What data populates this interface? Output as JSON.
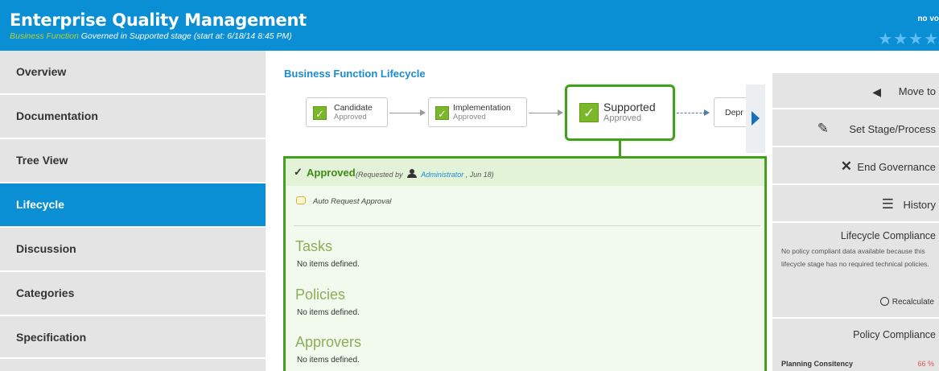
{
  "header": {
    "title": "Enterprise Quality Management",
    "type": "Business Function",
    "governance": "Governed in Supported stage (start at: 6/18/14 8:45 PM)",
    "votes": "no vo",
    "stars": "★★★★"
  },
  "nav": {
    "items": [
      {
        "label": "Overview"
      },
      {
        "label": "Documentation"
      },
      {
        "label": "Tree View"
      },
      {
        "label": "Lifecycle"
      },
      {
        "label": "Discussion"
      },
      {
        "label": "Categories"
      },
      {
        "label": "Specification"
      }
    ],
    "active": "Lifecycle"
  },
  "lifecycle": {
    "title": "Business Function Lifecycle",
    "stages": [
      {
        "name": "Candidate",
        "status": "Approved"
      },
      {
        "name": "Implementation",
        "status": "Approved"
      },
      {
        "name": "Supported",
        "status": "Approved"
      },
      {
        "name": "Depr",
        "status": ""
      }
    ],
    "check_glyph": "✓"
  },
  "approval": {
    "label": "Approved",
    "requested_by_prefix": "(Requested by",
    "user": "Administrator",
    "date": ", Jun 18)",
    "auto_request": "Auto Request Approval",
    "check_glyph": "✓"
  },
  "sections": [
    {
      "title": "Tasks",
      "empty": "No items defined."
    },
    {
      "title": "Policies",
      "empty": "No items defined."
    },
    {
      "title": "Approvers",
      "empty": "No items defined."
    }
  ],
  "actions": {
    "move_to": "Move to",
    "set_stage": "Set Stage/Process",
    "end_governance": "End Governance",
    "history": "History"
  },
  "lifecycle_compliance": {
    "title": "Lifecycle Compliance",
    "text": "No policy compliant data available because this lifecycle stage has no required technical policies.",
    "recalculate": "Recalculate"
  },
  "policy_compliance": {
    "title": "Policy Compliance",
    "rows": [
      {
        "name": "Planning Consitency",
        "value": "66 %"
      }
    ]
  },
  "colors": {
    "header_blue": "#0b8fd4",
    "approved_green": "#43a01d",
    "warning_red": "#d9534f"
  },
  "icons": [
    "star-icon",
    "check-icon",
    "user-icon",
    "comment-icon",
    "triangle-left-icon",
    "pencil-icon",
    "close-x-icon",
    "menu-lines-icon",
    "circle-icon",
    "chevron-right-icon"
  ]
}
